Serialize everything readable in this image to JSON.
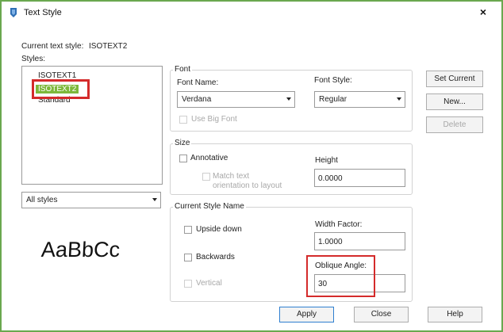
{
  "window": {
    "title": "Text Style",
    "close_glyph": "×"
  },
  "current_style": {
    "label": "Current text style:",
    "value": "ISOTEXT2"
  },
  "styles": {
    "label": "Styles:",
    "items": [
      "ISOTEXT1",
      "ISOTEXT2",
      "Standard"
    ],
    "selected": "ISOTEXT2",
    "filter_value": "All styles"
  },
  "preview_text": "AaBbCc",
  "font": {
    "group_title": "Font",
    "name_label": "Font Name:",
    "name_value": "Verdana",
    "style_label": "Font Style:",
    "style_value": "Regular",
    "big_font_label": "Use Big Font"
  },
  "size": {
    "group_title": "Size",
    "annotative_label": "Annotative",
    "match_line1": "Match text",
    "match_line2": "orientation to layout",
    "height_label": "Height",
    "height_value": "0.0000"
  },
  "effects": {
    "group_title": "Current Style Name",
    "upside_down_label": "Upside down",
    "backwards_label": "Backwards",
    "vertical_label": "Vertical",
    "width_factor_label": "Width Factor:",
    "width_factor_value": "1.0000",
    "oblique_label": "Oblique Angle:",
    "oblique_value": "30"
  },
  "buttons": {
    "set_current": "Set Current",
    "new": "New...",
    "delete": "Delete",
    "apply": "Apply",
    "close": "Close",
    "help": "Help"
  },
  "colors": {
    "selection": "#7db83a",
    "highlight_box": "#d42b2b",
    "frame": "#6aa84f"
  }
}
